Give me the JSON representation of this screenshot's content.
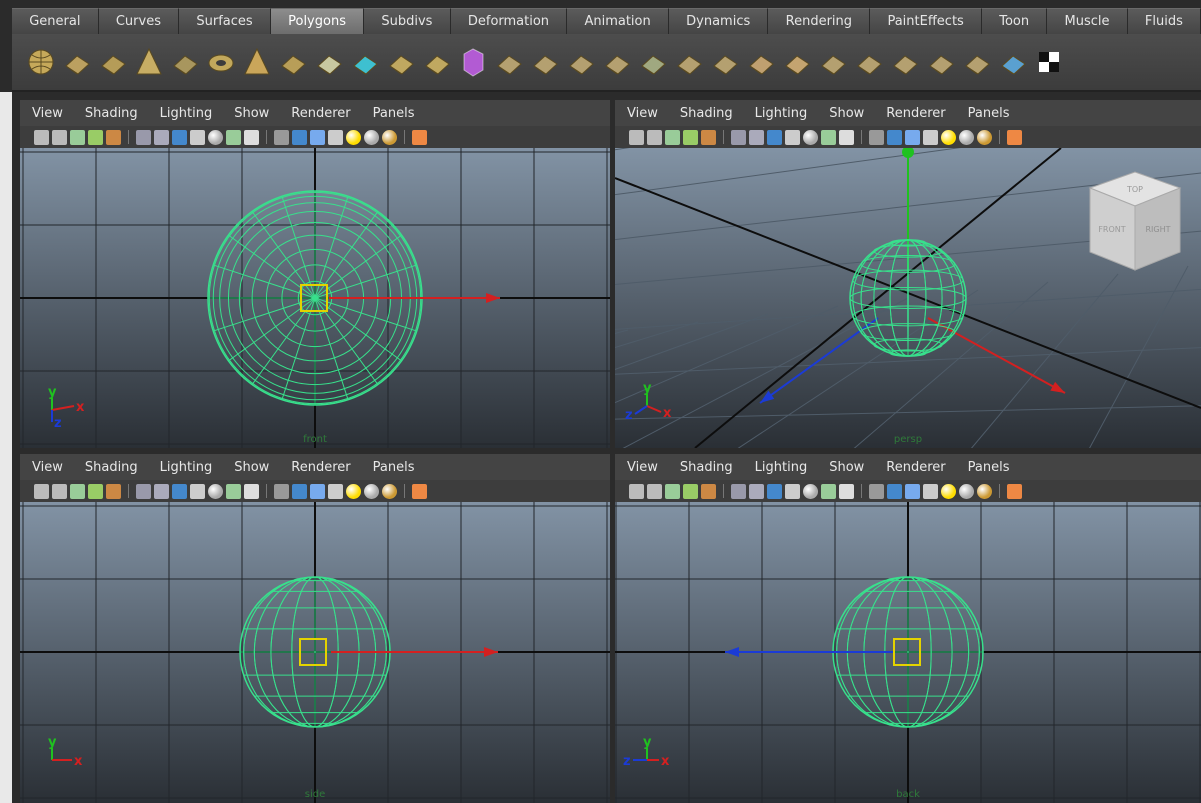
{
  "shelf": {
    "tabs": [
      "General",
      "Curves",
      "Surfaces",
      "Polygons",
      "Subdivs",
      "Deformation",
      "Animation",
      "Dynamics",
      "Rendering",
      "PaintEffects",
      "Toon",
      "Muscle",
      "Fluids"
    ],
    "active_tab": "Polygons",
    "icons": [
      "sphere-icon",
      "cube-icon",
      "cylinder-icon",
      "cone-icon",
      "plane-icon",
      "torus-icon",
      "pyramid-icon",
      "pipe-icon",
      "soccer-ball-icon",
      "separate-icon",
      "combine-icon",
      "smooth-icon",
      "mirror-cube-icon",
      "extrude-icon",
      "append-icon",
      "split-icon",
      "insert-edge-icon",
      "merge-icon",
      "bevel-icon",
      "wedge-icon",
      "bridge-icon",
      "poke-icon",
      "chamfer-icon",
      "collapse-icon",
      "reduce-icon",
      "sculpt-icon",
      "paint-weights-icon",
      "uv-map-icon",
      "checker-icon"
    ]
  },
  "panel_menu": [
    "View",
    "Shading",
    "Lighting",
    "Show",
    "Renderer",
    "Panels"
  ],
  "panels": [
    {
      "name": "front-panel",
      "kind": "ortho-front",
      "label": "front"
    },
    {
      "name": "persp-panel",
      "kind": "perspective",
      "label": "persp",
      "viewcube": {
        "top": "TOP",
        "front": "FRONT",
        "right": "RIGHT"
      }
    },
    {
      "name": "side-panel",
      "kind": "ortho-side",
      "label": "side"
    },
    {
      "name": "back-panel",
      "kind": "ortho-back",
      "label": "back"
    }
  ],
  "axis_labels": {
    "x": "x",
    "y": "y",
    "z": "z"
  },
  "colors": {
    "wireframe": "#38e08c",
    "axis_x": "#d42020",
    "axis_y": "#1fc21f",
    "axis_z": "#1b3bd6",
    "manipulator": "#e4d300",
    "active_tab": "#7d7d7d",
    "viewport_top": "#8293a5",
    "viewport_bottom": "#2a2f35"
  }
}
